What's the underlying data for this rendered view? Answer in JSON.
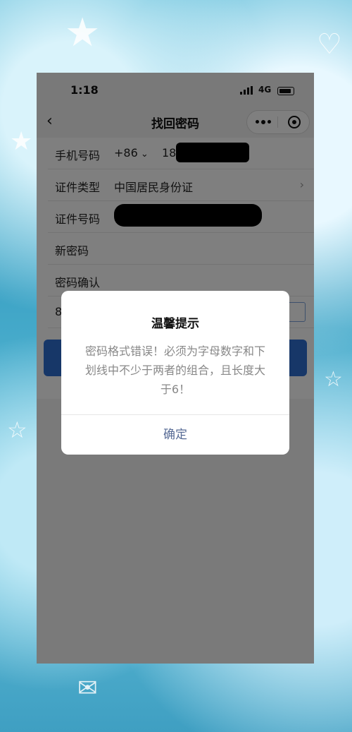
{
  "status_bar": {
    "time": "1:18",
    "network": "4G"
  },
  "nav": {
    "title": "找回密码"
  },
  "form": {
    "phone_label": "手机号码",
    "country_code": "+86",
    "phone_prefix": "18",
    "id_type_label": "证件类型",
    "id_type_value": "中国居民身份证",
    "id_number_label": "证件号码",
    "new_password_label": "新密码",
    "confirm_password_label": "密码确认",
    "captcha_partial": "8"
  },
  "dialog": {
    "title": "温馨提示",
    "message": "密码格式错误！必须为字母数字和下划线中不少于两者的组合，且长度大于6！",
    "confirm_label": "确定"
  },
  "colors": {
    "primary_button": "#2f6fd1",
    "dialog_button_text": "#576b95",
    "wallpaper_blue": "#4fb3d1"
  }
}
